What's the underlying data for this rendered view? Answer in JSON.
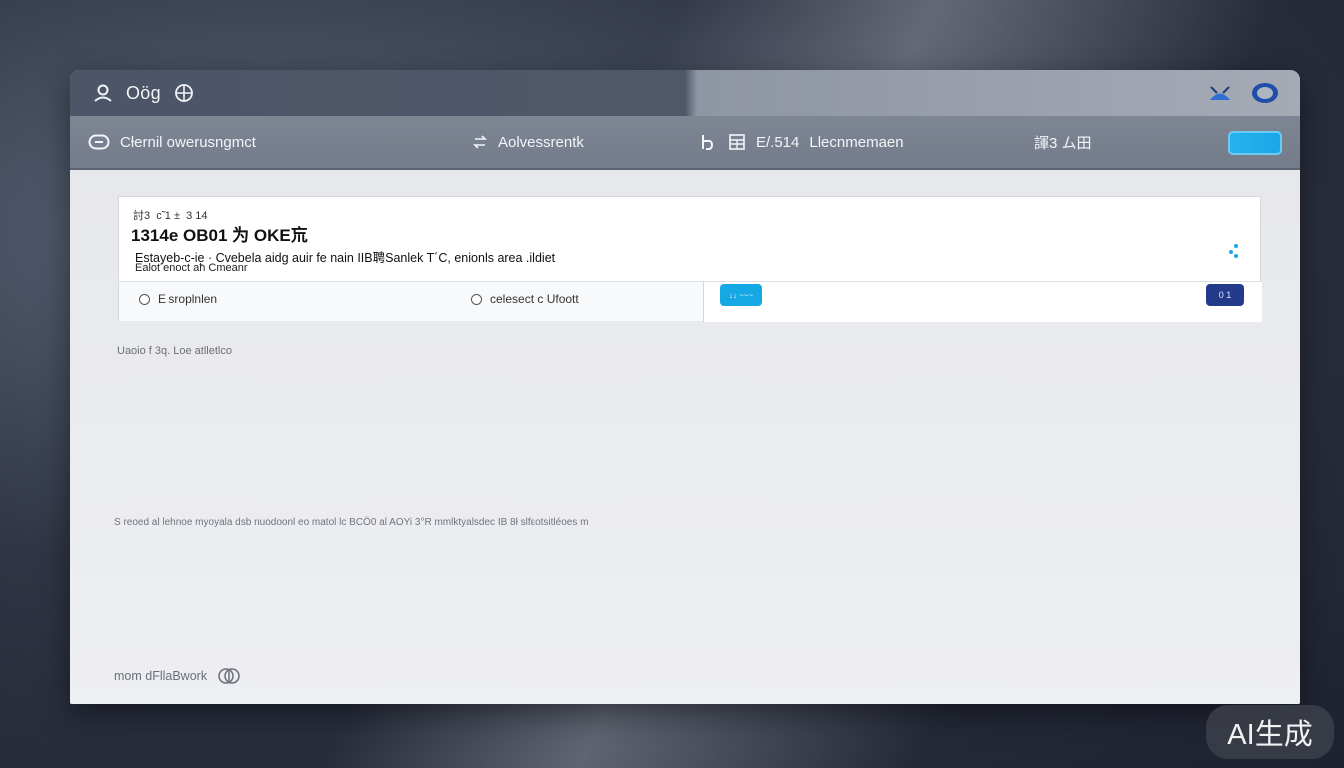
{
  "titlebar": {
    "icons": [
      "user-icon",
      "globe-icon",
      "chart-icon",
      "profile-icon"
    ],
    "app_name": "Oög"
  },
  "toolbar": {
    "icons": [
      "link-icon",
      "swap-icon",
      "refresh-icon",
      "calculator-icon"
    ],
    "title": "Cƚernil owerusngmct",
    "item2": "Aolvessrentk",
    "item3_code": "E/.514",
    "item3_label": "Llecnmemaen",
    "item4": "諢3 ム田",
    "toggle_state": "on",
    "accent": "#1aa7e8"
  },
  "card": {
    "meta": "討3  с̃ 1 ±  3 14",
    "heading": "1314e OB01 为 OKE巟",
    "desc1": "Estayeb-с-ie · Cvebela aidg auir fe nain IIB聘Sanlek  T´C, enionls area .ildiet",
    "desc2": "Ealot enoсt aħ Cmeanr",
    "option1": "E sroplnlen",
    "option2": "celesect c Ufoott",
    "chip_blue": "↓↓ ~~~",
    "chip_navy": "0 1",
    "chip_blue_color": "#16a8e4",
    "chip_navy_color": "#233a8a"
  },
  "section_label": "Uaoio f 3q. Loe atlletlco",
  "note": "S reoed  al lehnoe myoyala dsb nuodoonl eo matol lc BCÖ0 al AOYi   3°R mmlktyalsdec IB 8ł slfεotsitléoes m",
  "footer": {
    "text": "mom dFllaBwork",
    "icon": "add-icon"
  },
  "watermark": "AI生成"
}
